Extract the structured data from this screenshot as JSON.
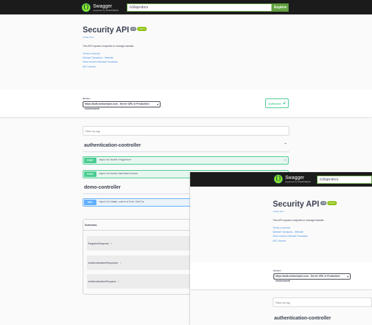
{
  "topbar": {
    "logo_name": "Swagger",
    "logo_sub": "supported by SMARTBEAR",
    "url_value": "/v3/api-docs",
    "explore_label": "Explore"
  },
  "info": {
    "title": "Security API",
    "version": "1.0",
    "oas": "OAS3",
    "spec_link": "/v3/api-docs",
    "description": "This API exposes endpoints to manage tutorials.",
    "links": [
      "Terms of service",
      "Michael Tomaszko - Website",
      "Send email to Michael Tomaszko",
      "MIT License"
    ]
  },
  "servers": {
    "label": "Servers",
    "selected": "https://auth.mebomeplo.com - Server URL in Production environment"
  },
  "authorize_label": "Authorize",
  "filter_placeholder": "Filter by tag",
  "tags": [
    {
      "name": "authentication-controller",
      "ops": [
        {
          "method": "POST",
          "path": "/api/v1/auth/register"
        },
        {
          "method": "POST",
          "path": "/api/v1/auth/authenticate"
        }
      ]
    },
    {
      "name": "demo-controller",
      "ops": [
        {
          "method": "GET",
          "path": "/api/v1/demo-controller/hello"
        }
      ]
    }
  ],
  "schemas": {
    "title": "Schemas",
    "models": [
      "RegisterRequest",
      "AuthenticationResponse",
      "AuthenticationRequest"
    ]
  },
  "overlay": {
    "url_value": "/v3/api-docs",
    "tag_name": "authentication-controller"
  },
  "colors": {
    "topbar": "#1b1b1b",
    "explore_green": "#62a03f",
    "post": "#49cc90",
    "get": "#61affe",
    "link": "#4990e2"
  }
}
